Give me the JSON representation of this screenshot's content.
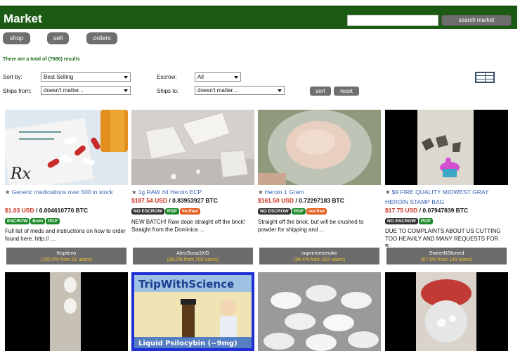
{
  "header": {
    "brand": "Market",
    "search_placeholder": "",
    "search_button": "search market"
  },
  "nav": {
    "shop": "shop",
    "sell": "sell",
    "orders": "orders"
  },
  "results_text": "There are a total of (7680) results",
  "filters": {
    "sort_label": "Sort by:",
    "sort_value": "Best Selling",
    "escrow_label": "Escrow:",
    "escrow_value": "All",
    "ships_from_label": "Ships from:",
    "ships_from_value": "doesn't matter...",
    "ships_to_label": "Ships to:",
    "ships_to_value": "doesn't matter...",
    "sort_button": "sort",
    "reset_button": "reset"
  },
  "listings": [
    {
      "title": "Generic medications over 500 in stock",
      "price_usd": "$1.03 USD",
      "price_btc": "0.004610770 BTC",
      "badges": [
        "ESCROW",
        "Both",
        "PGP"
      ],
      "description": "Full list of meds and instructions on how to order found here. http:// ...",
      "seller": "Koptevo",
      "rating": "(100.0% from 21 users)"
    },
    {
      "title": "1g RAW #4 Heroin ECP",
      "price_usd": "$187.54 USD",
      "price_btc": "0.83953927 BTC",
      "badges": [
        "NO ESCROW",
        "PGP",
        "Verified"
      ],
      "description": "NEW BATCH! Raw dope straight off the brick! Straight from the Dominica ...",
      "seller": "AlexSosa1KG",
      "rating": "(98.0% from 702 users)"
    },
    {
      "title": "Heroin 1 Gram",
      "price_usd": "$161.50 USD",
      "price_btc": "0.72297183 BTC",
      "badges": [
        "NO ESCROW",
        "PGP",
        "Verified"
      ],
      "description": "Straight off the brick, but will be crushed to powder for shipping and ...",
      "seller": "supremesmoke",
      "rating": "(98.4% from 315 users)"
    },
    {
      "title": "$9 FIRE QUALITY MIDWEST GRAY HEROIN STAMP BAG",
      "price_usd": "$17.75 USD",
      "price_btc": "0.07947839 BTC",
      "badges": [
        "NO ESCROW",
        "PGP"
      ],
      "description": "DUE TO COMPLAINTS ABOUT US CUTTING TOO HEAVILY AND MANY REQUESTS FOR B...",
      "seller": "SweetNStoned",
      "rating": "(87.9% from 140 users)"
    }
  ],
  "row2_images": {
    "trip_title": "TripWithScience",
    "trip_caption": "Liquid Psilocybin (~9mg)"
  }
}
